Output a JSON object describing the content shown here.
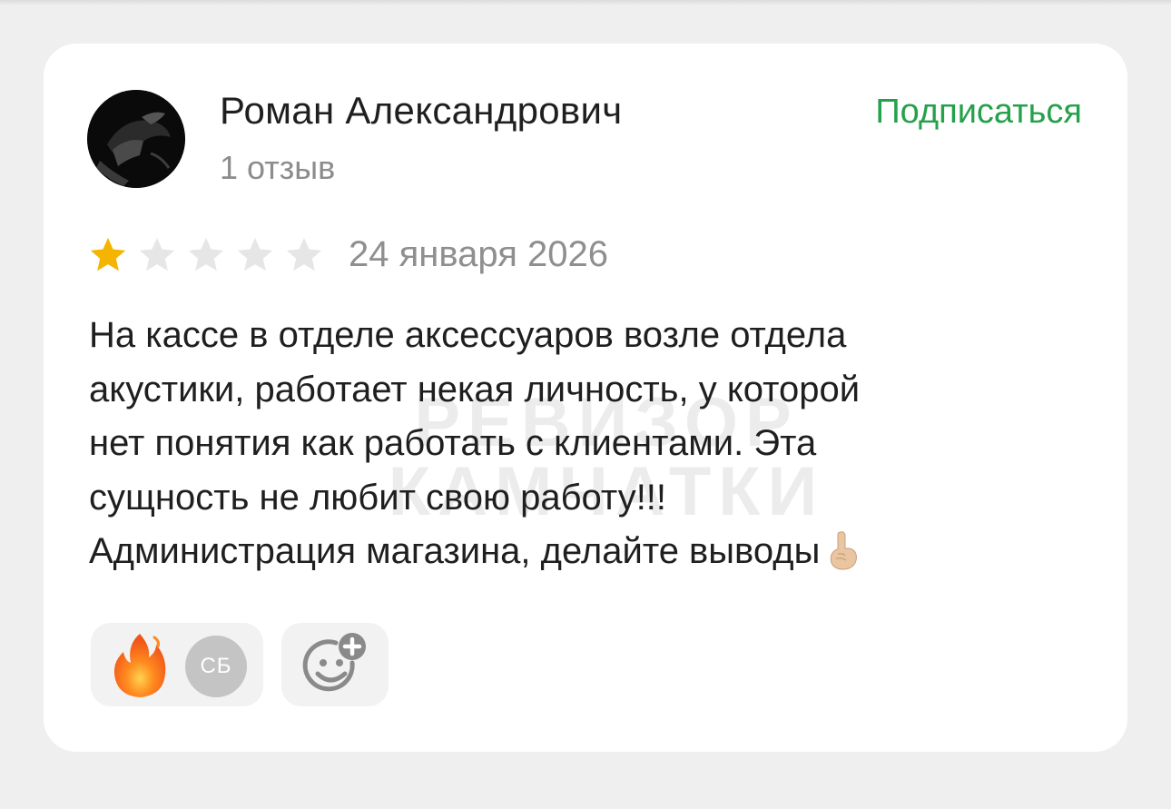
{
  "author": {
    "name": "Роман Александрович",
    "review_count": "1 отзыв"
  },
  "subscribe_label": "Подписаться",
  "rating": {
    "value": 1,
    "max": 5,
    "filled_color": "#f4b400",
    "empty_color": "#e6e6e6"
  },
  "review_date": "24 января 2026",
  "review_text_lines": [
    "На кассе в отделе аксессуаров возле отдела",
    "акустики, работает некая личность, у которой",
    "нет понятия как работать с клиентами. Эта",
    "сущность не любит свою работу!!!",
    "Администрация магазина, делайте выводы"
  ],
  "review_text_trailing_emoji": "pointing-up-hand-icon",
  "watermark": {
    "line1": "РЕВИЗОР",
    "line2": "КАМЧАТКИ"
  },
  "reactions": {
    "emoji_icon": "fire-icon",
    "user_initials": "СБ",
    "add_icon": "add-reaction-icon"
  },
  "colors": {
    "accent": "#26a14b",
    "background": "#efefef",
    "card": "#ffffff",
    "muted_text": "#8c8c8c"
  }
}
